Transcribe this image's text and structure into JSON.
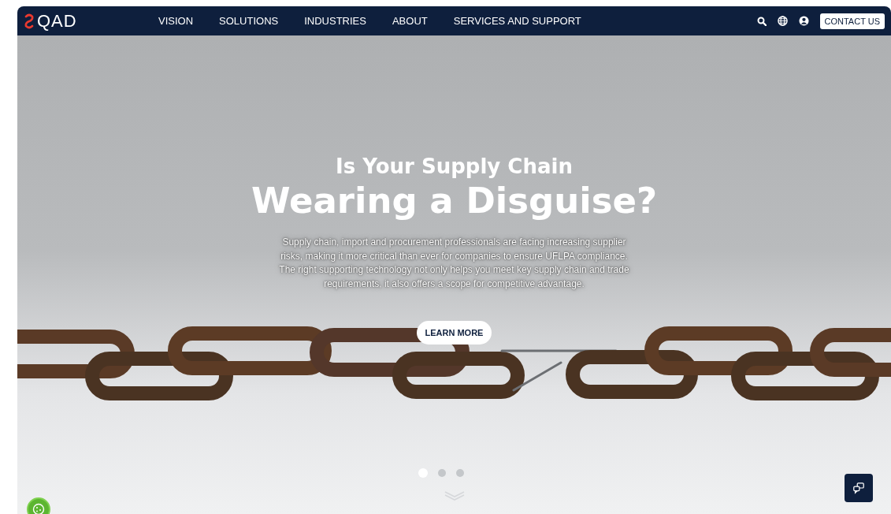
{
  "header": {
    "logo": "QAD",
    "nav": [
      {
        "label": "VISION"
      },
      {
        "label": "SOLUTIONS"
      },
      {
        "label": "INDUSTRIES"
      },
      {
        "label": "ABOUT"
      },
      {
        "label": "SERVICES AND SUPPORT"
      }
    ],
    "contact_button": "CONTACT US"
  },
  "hero": {
    "kicker": "Is Your Supply Chain",
    "title": "Wearing a Disguise?",
    "body": "Supply chain, import and procurement professionals are facing increasing supplier risks, making it more critical than ever for companies to ensure UFLPA compliance. The right supporting technology not only helps you meet key supply chain and trade requirements, it also offers a scope for competitive advantage.",
    "button": "LEARN MORE"
  },
  "slides": [
    {
      "selected": true
    },
    {
      "selected": false
    },
    {
      "selected": false
    }
  ]
}
